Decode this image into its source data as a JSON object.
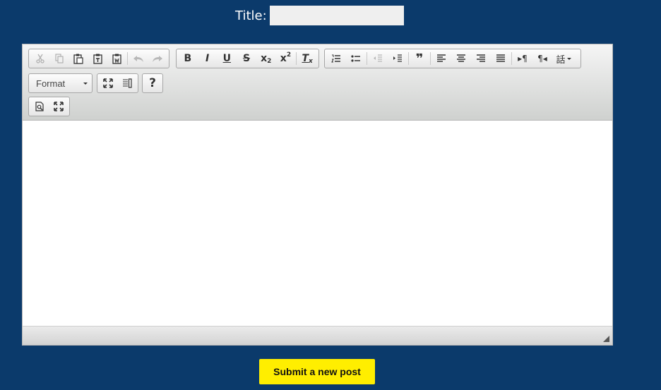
{
  "form": {
    "title_label": "Title:",
    "title_value": "",
    "submit_label": "Submit a new post"
  },
  "toolbar": {
    "format_label": "Format",
    "help_label": "?"
  },
  "colors": {
    "page_background": "#0b3a6b",
    "submit_background": "#ffee00",
    "title_input_background": "#efefef"
  }
}
